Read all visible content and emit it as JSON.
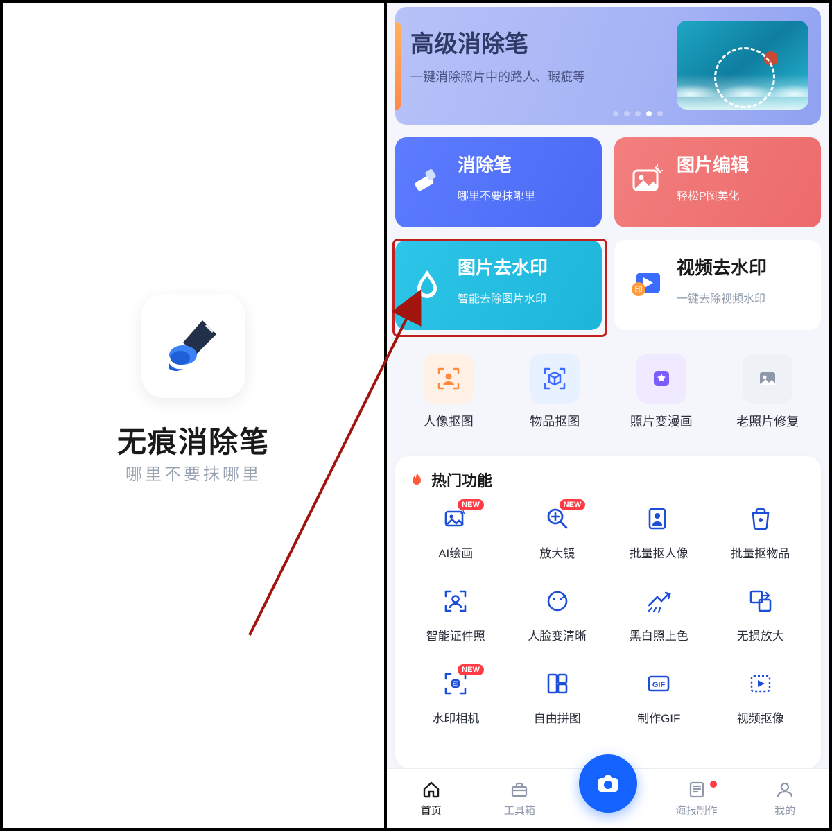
{
  "splash": {
    "title": "无痕消除笔",
    "subtitle": "哪里不要抹哪里"
  },
  "banner": {
    "title": "高级消除笔",
    "subtitle": "一键消除照片中的路人、瑕疵等",
    "dots_total": 5,
    "active_dot_index": 3
  },
  "cards": {
    "eraser": {
      "title": "消除笔",
      "sub": "哪里不要抹哪里"
    },
    "edit": {
      "title": "图片编辑",
      "sub": "轻松P图美化"
    },
    "img_wm": {
      "title": "图片去水印",
      "sub": "智能去除图片水印"
    },
    "vid_wm": {
      "title": "视频去水印",
      "sub": "一键去除视频水印"
    }
  },
  "tools": [
    {
      "label": "人像抠图"
    },
    {
      "label": "物品抠图"
    },
    {
      "label": "照片变漫画"
    },
    {
      "label": "老照片修复"
    }
  ],
  "hot": {
    "title": "热门功能",
    "badge_text": "NEW",
    "items": [
      {
        "label": "AI绘画",
        "new": true
      },
      {
        "label": "放大镜",
        "new": true
      },
      {
        "label": "批量抠人像",
        "new": false
      },
      {
        "label": "批量抠物品",
        "new": false
      },
      {
        "label": "智能证件照",
        "new": false
      },
      {
        "label": "人脸变清晰",
        "new": false
      },
      {
        "label": "黑白照上色",
        "new": false
      },
      {
        "label": "无损放大",
        "new": false
      },
      {
        "label": "水印相机",
        "new": true
      },
      {
        "label": "自由拼图",
        "new": false
      },
      {
        "label": "制作GIF",
        "new": false
      },
      {
        "label": "视频抠像",
        "new": false
      }
    ]
  },
  "nav": {
    "items": [
      {
        "label": "首页"
      },
      {
        "label": "工具箱"
      },
      {
        "label": ""
      },
      {
        "label": "海报制作"
      },
      {
        "label": "我的"
      }
    ],
    "active_index": 0,
    "dot_index": 3
  },
  "colors": {
    "accent_blue": "#1463ff",
    "highlight_red": "#c21f1f",
    "badge_red": "#ff3b46"
  }
}
